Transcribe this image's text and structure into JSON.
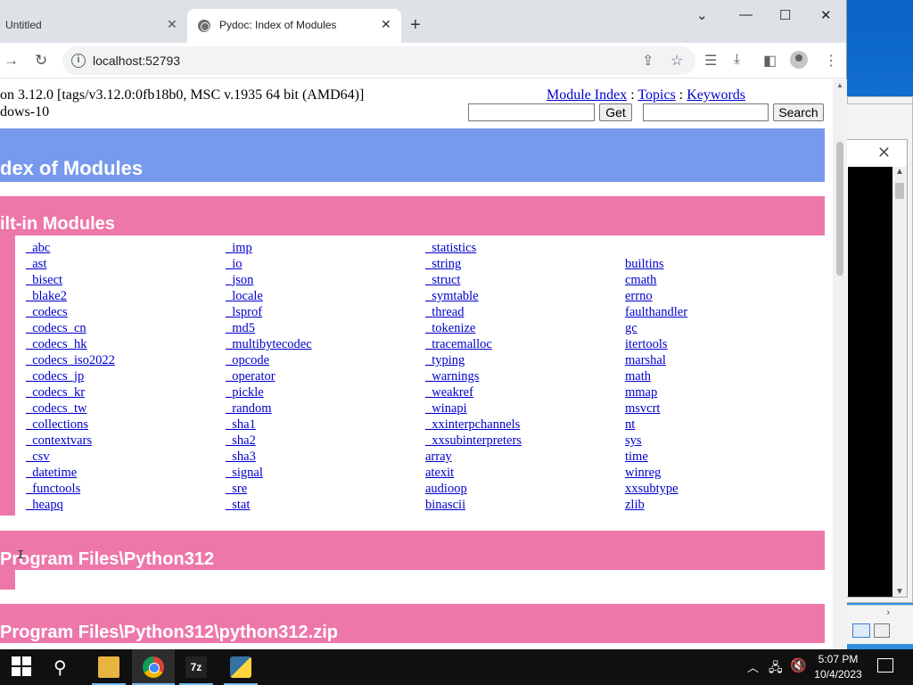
{
  "browser": {
    "tabs": [
      {
        "title": "Untitled"
      },
      {
        "title": "Pydoc: Index of Modules"
      }
    ],
    "url": "localhost:52793"
  },
  "page": {
    "version_line": "on 3.12.0 [tags/v3.12.0:0fb18b0, MSC v.1935 64 bit (AMD64)]",
    "platform_line": "dows-10",
    "nav": {
      "module_index": "Module Index",
      "sep1": " : ",
      "topics": "Topics",
      "sep2": " : ",
      "keywords": "Keywords"
    },
    "get_button": "Get",
    "search_button": "Search",
    "title_banner": "dex of Modules",
    "builtin_banner": "ilt-in Modules",
    "columns": [
      [
        "_abc",
        "_ast",
        "_bisect",
        "_blake2",
        "_codecs",
        "_codecs_cn",
        "_codecs_hk",
        "_codecs_iso2022",
        "_codecs_jp",
        "_codecs_kr",
        "_codecs_tw",
        "_collections",
        "_contextvars",
        "_csv",
        "_datetime",
        "_functools",
        "_heapq"
      ],
      [
        "_imp",
        "_io",
        "_json",
        "_locale",
        "_lsprof",
        "_md5",
        "_multibytecodec",
        "_opcode",
        "_operator",
        "_pickle",
        "_random",
        "_sha1",
        "_sha2",
        "_sha3",
        "_signal",
        "_sre",
        "_stat"
      ],
      [
        "_statistics",
        "_string",
        "_struct",
        "_symtable",
        "_thread",
        "_tokenize",
        "_tracemalloc",
        "_typing",
        "_warnings",
        "_weakref",
        "_winapi",
        "_xxinterpchannels",
        "_xxsubinterpreters",
        "array",
        "atexit",
        "audioop",
        "binascii"
      ],
      [
        "builtins",
        "cmath",
        "errno",
        "faulthandler",
        "gc",
        "itertools",
        "marshal",
        "math",
        "mmap",
        "msvcrt",
        "nt",
        "sys",
        "time",
        "winreg",
        "xxsubtype",
        "zlib"
      ]
    ],
    "dir1_banner": "Program Files\\Python312",
    "dir2_banner": "Program Files\\Python312\\python312.zip"
  },
  "taskbar": {
    "zip_label": "7z",
    "time": "5:07 PM",
    "date": "10/4/2023"
  }
}
